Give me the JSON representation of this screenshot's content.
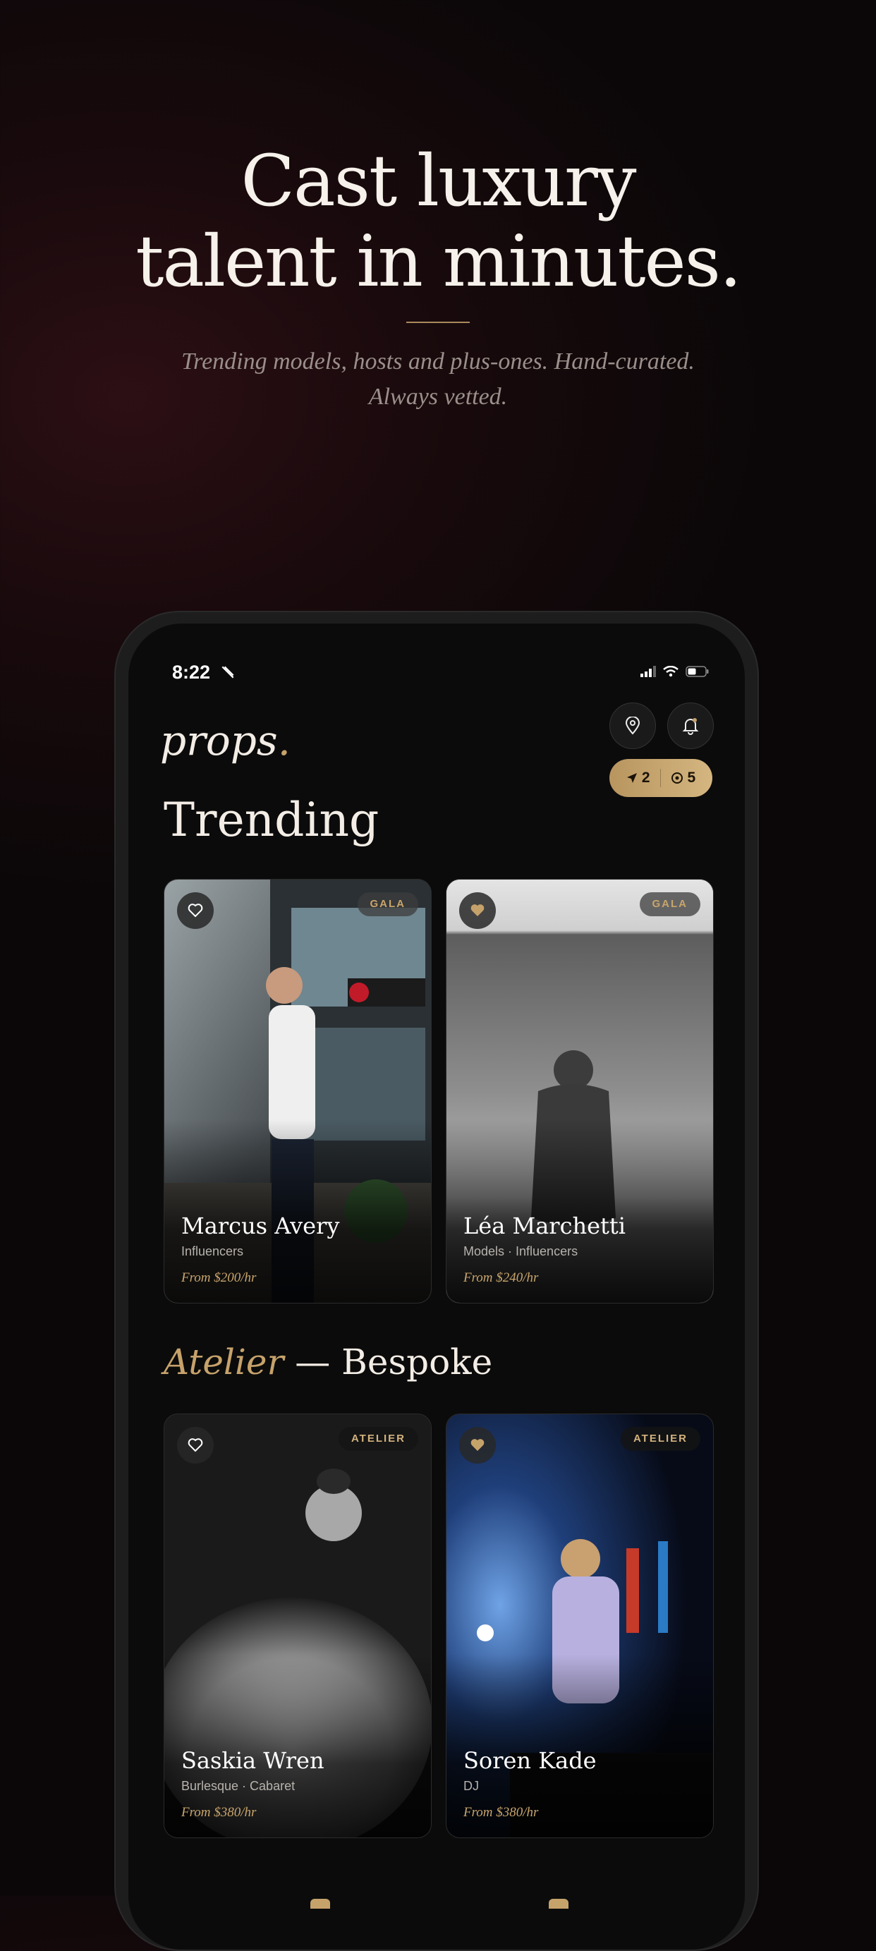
{
  "hero": {
    "title_line1": "Cast luxury",
    "title_line2": "talent in minutes.",
    "subtitle_line1": "Trending models, hosts and plus-ones. Hand-curated.",
    "subtitle_line2": "Always vetted."
  },
  "status_bar": {
    "time": "8:22"
  },
  "app": {
    "logo": "props",
    "logo_dot": ".",
    "badge": {
      "location_count": "2",
      "alerts_count": "5"
    }
  },
  "trending": {
    "title": "Trending",
    "cards": [
      {
        "name": "Marcus Avery",
        "category": "Influencers",
        "price": "From $200/hr",
        "tag": "GALA",
        "favorited": false
      },
      {
        "name": "Léa Marchetti",
        "category": "Models · Influencers",
        "price": "From $240/hr",
        "tag": "GALA",
        "favorited": true
      }
    ]
  },
  "atelier": {
    "title_italic": "Atelier",
    "title_rest": " — Bespoke",
    "cards": [
      {
        "name": "Saskia Wren",
        "category": "Burlesque · Cabaret",
        "price": "From $380/hr",
        "tag": "ATELIER",
        "favorited": false
      },
      {
        "name": "Soren Kade",
        "category": "DJ",
        "price": "From $380/hr",
        "tag": "ATELIER",
        "favorited": true
      }
    ]
  },
  "colors": {
    "accent_gold": "#c6a26b",
    "background": "#0b0b0b"
  }
}
